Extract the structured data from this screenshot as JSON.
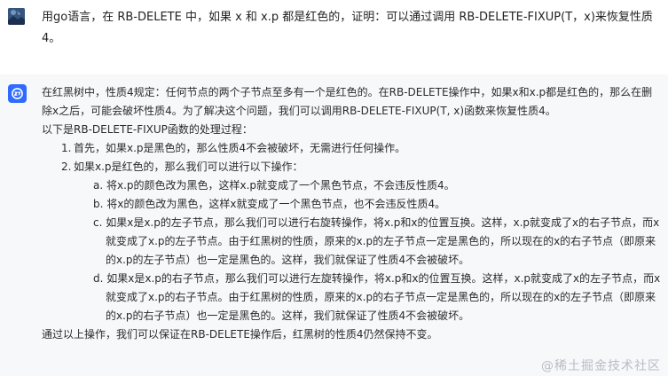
{
  "question": {
    "text": "用go语言，在 RB-DELETE 中，如果 x 和 x.p 都是红色的，证明：可以通过调用 RB-DELETE-FIXUP(T，x)来恢复性质 4。"
  },
  "answer": {
    "intro": "在红黑树中，性质4规定：任何节点的两个子节点至多有一个是红色的。在RB-DELETE操作中，如果x和x.p都是红色的，那么在删除x之后，可能会破坏性质4。为了解决这个问题，我们可以调用RB-DELETE-FIXUP(T, x)函数来恢复性质4。",
    "process_heading": "以下是RB-DELETE-FIXUP函数的处理过程：",
    "steps": [
      {
        "num": "1.",
        "text": "首先，如果x.p是黑色的，那么性质4不会被破坏，无需进行任何操作。"
      },
      {
        "num": "2.",
        "text": "如果x.p是红色的，那么我们可以进行以下操作："
      }
    ],
    "substeps": [
      "a. 将x.p的颜色改为黑色，这样x.p就变成了一个黑色节点，不会违反性质4。",
      "b. 将x的颜色改为黑色，这样x就变成了一个黑色节点，也不会违反性质4。",
      "c. 如果x是x.p的左子节点，那么我们可以进行右旋转操作，将x.p和x的位置互换。这样，x.p就变成了x的右子节点，而x就变成了x.p的左子节点。由于红黑树的性质，原来的x.p的左子节点一定是黑色的，所以现在的x的右子节点（即原来的x.p的左子节点）也一定是黑色的。这样，我们就保证了性质4不会被破坏。",
      "d. 如果x是x.p的右子节点，那么我们可以进行左旋转操作，将x.p和x的位置互换。这样，x.p就变成了x的左子节点，而x就变成了x.p的右子节点。由于红黑树的性质，原来的x.p的右子节点一定是黑色的，所以现在的x的左子节点（即原来的x.p的右子节点）也一定是黑色的。这样，我们就保证了性质4不会被破坏。"
    ],
    "conclusion": "通过以上操作，我们可以保证在RB-DELETE操作后，红黑树的性质4仍然保持不变。"
  },
  "watermark": {
    "text": "@稀土掘金技术社区"
  },
  "colors": {
    "answer_bg": "#f7f8fa",
    "bot_avatar": "#2f6bff",
    "text": "#2b2b2b",
    "watermark": "#b8bcc4"
  }
}
